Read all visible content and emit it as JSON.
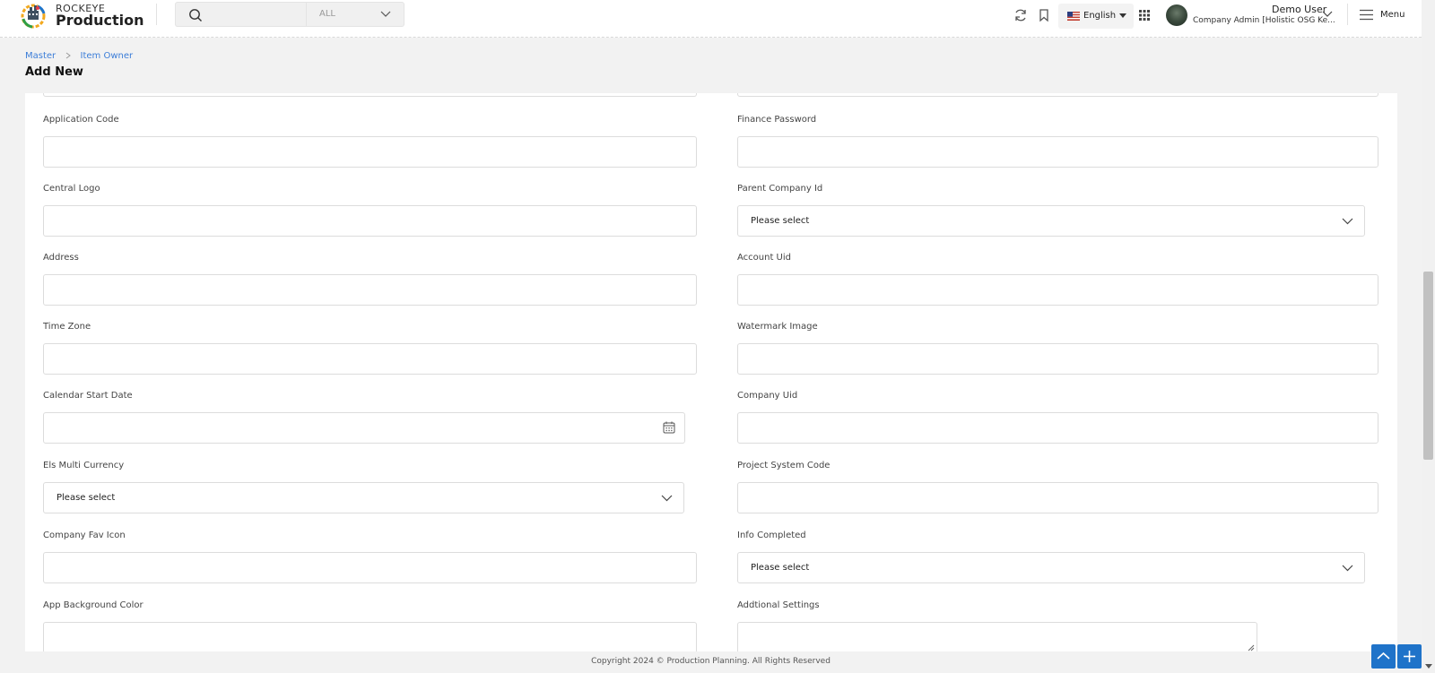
{
  "header": {
    "brand_top": "ROCKEYE",
    "brand_main": "Production",
    "search_placeholder": "",
    "scope": "ALL",
    "language": "English",
    "user_name": "Demo User",
    "user_role": "Company Admin [Holistic OSG Ke..."
  },
  "menu": {
    "label": "Menu"
  },
  "breadcrumb": {
    "root": "Master",
    "current": "Item Owner"
  },
  "page_title": "Add New",
  "form": {
    "left": {
      "application_code": "Application Code",
      "central_logo": "Central Logo",
      "address": "Address",
      "time_zone": "Time Zone",
      "calendar_start_date": "Calendar Start Date",
      "els_multi_currency": "Els Multi Currency",
      "els_multi_currency_value": "Please select",
      "company_fav_icon": "Company Fav Icon",
      "app_background_color": "App Background Color"
    },
    "right": {
      "finance_password": "Finance Password",
      "parent_company_id": "Parent Company Id",
      "parent_company_id_value": "Please select",
      "account_uid": "Account Uid",
      "watermark_image": "Watermark Image",
      "company_uid": "Company Uid",
      "project_system_code": "Project System Code",
      "info_completed": "Info Completed",
      "info_completed_value": "Please select",
      "additional_settings": "Addtional Settings"
    }
  },
  "footer": {
    "copyright": "Copyright 2024 © Production Planning. All Rights Reserved"
  },
  "colors": {
    "accent": "#1f73c9",
    "link": "#3b7dd8"
  }
}
